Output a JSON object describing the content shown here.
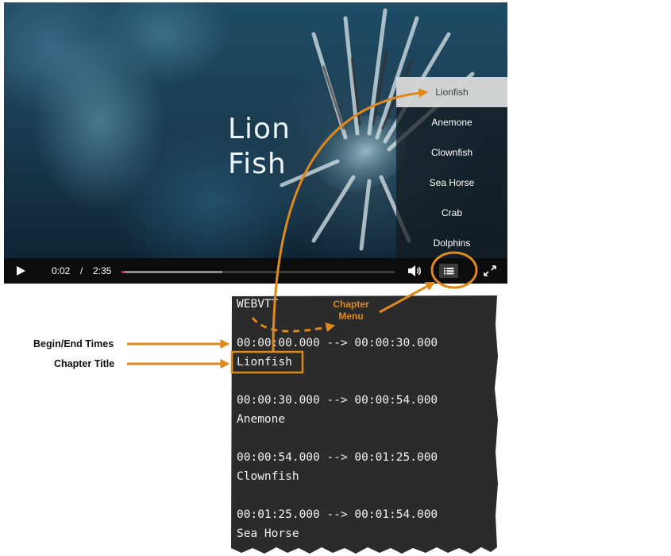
{
  "player": {
    "video_title_line1": "Lion",
    "video_title_line2": "Fish",
    "chapters": [
      "Lionfish",
      "Anemone",
      "Clownfish",
      "Sea Horse",
      "Crab",
      "Dolphins"
    ],
    "active_chapter": 0,
    "current_time": "0:02",
    "time_separator": "/",
    "duration": "2:35",
    "buffered_fraction": 0.37,
    "played_fraction": 0.013,
    "icons": {
      "play": "play-icon",
      "volume": "volume-icon",
      "chapters": "chapters-list-icon",
      "fullscreen": "fullscreen-icon"
    }
  },
  "webvtt": {
    "header": "WEBVTT",
    "cues": [
      {
        "timing": "00:00:00.000 --> 00:00:30.000",
        "title": "Lionfish"
      },
      {
        "timing": "00:00:30.000 --> 00:00:54.000",
        "title": "Anemone"
      },
      {
        "timing": "00:00:54.000 --> 00:01:25.000",
        "title": "Clownfish"
      },
      {
        "timing": "00:01:25.000 --> 00:01:54.000",
        "title": "Sea Horse"
      }
    ]
  },
  "annotations": {
    "begin_end_times": "Begin/End Times",
    "chapter_title": "Chapter Title",
    "chapter_menu_line1": "Chapter",
    "chapter_menu_line2": "Menu"
  },
  "colors": {
    "annotation_orange": "#e0891b",
    "code_background": "#2b2b2b",
    "seek_played": "#d8246a"
  }
}
